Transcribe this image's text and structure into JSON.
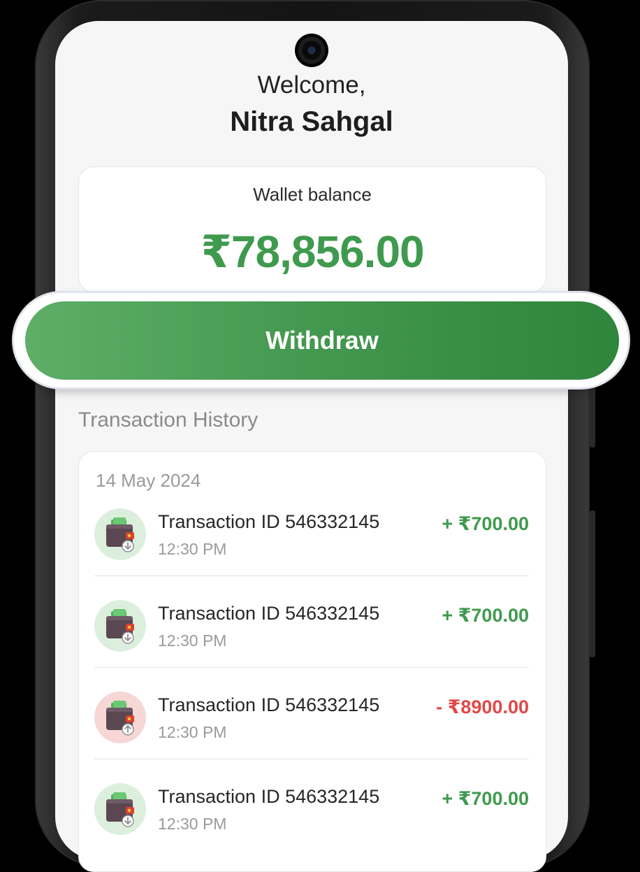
{
  "header": {
    "greeting": "Welcome,",
    "user_name": "Nitra Sahgal"
  },
  "wallet": {
    "label": "Wallet balance",
    "balance": "₹78,856.00"
  },
  "actions": {
    "withdraw_label": "Withdraw"
  },
  "history": {
    "title": "Transaction History",
    "date": "14 May 2024",
    "transactions": [
      {
        "title": "Transaction ID 546332145",
        "time": "12:30 PM",
        "amount": "+ ₹700.00",
        "type": "credit"
      },
      {
        "title": "Transaction ID 546332145",
        "time": "12:30 PM",
        "amount": "+ ₹700.00",
        "type": "credit"
      },
      {
        "title": "Transaction ID 546332145",
        "time": "12:30 PM",
        "amount": "- ₹8900.00",
        "type": "debit"
      },
      {
        "title": "Transaction ID 546332145",
        "time": "12:30 PM",
        "amount": "+ ₹700.00",
        "type": "credit"
      }
    ]
  },
  "colors": {
    "credit": "#3f9a4e",
    "debit": "#e24848",
    "credit_bg": "#dcefdd",
    "debit_bg": "#f7d6d6",
    "accent": "#43974f"
  },
  "icons": {
    "credit": "wallet-incoming-icon",
    "debit": "wallet-outgoing-icon"
  }
}
